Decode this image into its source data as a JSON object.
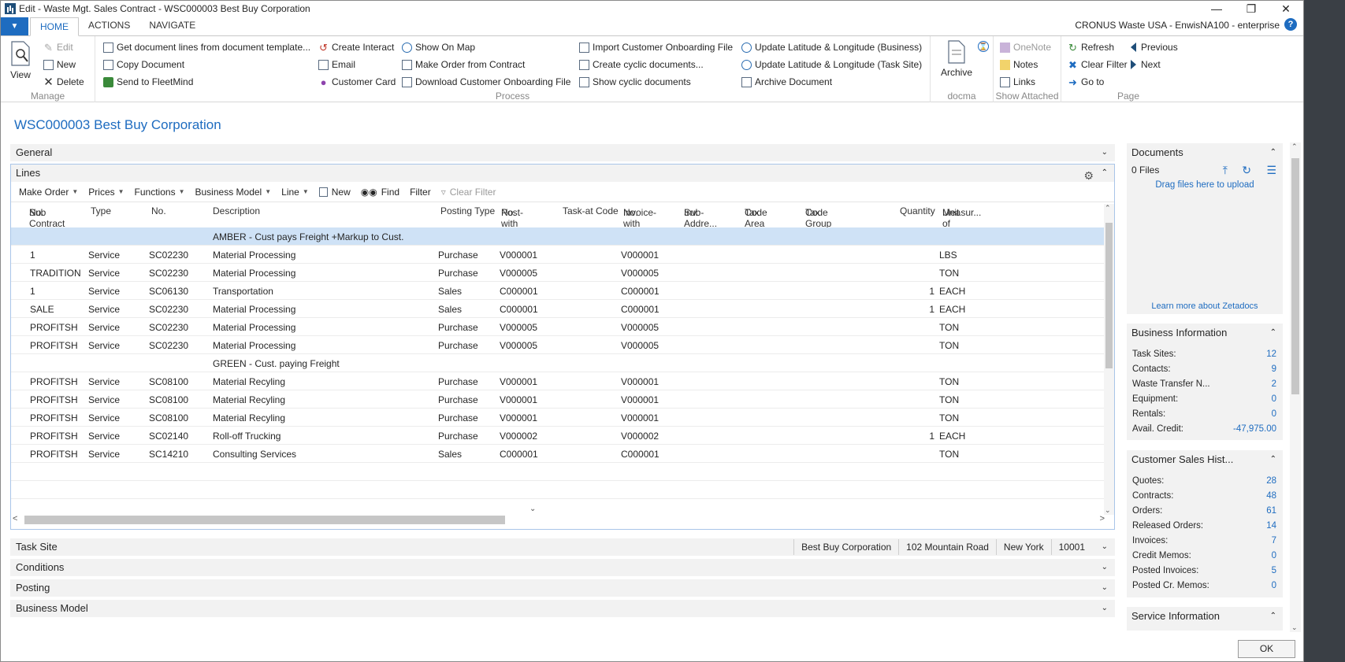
{
  "window": {
    "title": "Edit - Waste Mgt. Sales Contract - WSC000003 Best Buy Corporation",
    "company": "CRONUS Waste USA - EnwisNA100 - enterprise"
  },
  "tabs": [
    "HOME",
    "ACTIONS",
    "NAVIGATE"
  ],
  "ribbon": {
    "manage": {
      "label": "Manage",
      "view": "View",
      "edit": "Edit",
      "new": "New",
      "delete": "Delete"
    },
    "process": {
      "label": "Process",
      "get_lines": "Get document lines from document template...",
      "copy_document": "Copy Document",
      "send_fleetmind": "Send to FleetMind",
      "create_interact": "Create Interact",
      "email": "Email",
      "customer_card": "Customer Card",
      "show_on_map": "Show On Map",
      "make_order": "Make Order from Contract",
      "download_onboarding": "Download Customer  Onboarding File",
      "import_onboarding": "Import Customer Onboarding File",
      "create_cyclic": "Create cyclic documents...",
      "show_cyclic": "Show cyclic documents",
      "update_latlng_business": "Update Latitude & Longitude (Business)",
      "update_latlng_task": "Update Latitude & Longitude (Task Site)",
      "archive_document": "Archive Document"
    },
    "docma": {
      "label": "docma",
      "archive": "Archive"
    },
    "show_attached": {
      "label": "Show Attached",
      "onenote": "OneNote",
      "notes": "Notes",
      "links": "Links"
    },
    "page": {
      "label": "Page",
      "refresh": "Refresh",
      "clear_filter": "Clear Filter",
      "go_to": "Go to",
      "previous": "Previous",
      "next": "Next"
    }
  },
  "page_title": "WSC000003 Best Buy Corporation",
  "sections": {
    "general": "General",
    "lines": "Lines",
    "task_site": "Task Site",
    "conditions": "Conditions",
    "posting": "Posting",
    "business_model": "Business Model"
  },
  "lines_toolbar": {
    "make_order": "Make Order",
    "prices": "Prices",
    "functions": "Functions",
    "business_model": "Business Model",
    "line": "Line",
    "new": "New",
    "find": "Find",
    "filter": "Filter",
    "clear_filter": "Clear Filter"
  },
  "columns": {
    "sub_contract_no": [
      "Sub Contract",
      "No."
    ],
    "type": [
      "Type",
      ""
    ],
    "no": [
      "No.",
      ""
    ],
    "description": [
      "Description",
      ""
    ],
    "posting_type": [
      "Posting Type",
      ""
    ],
    "post_with_no": [
      "Post-with",
      "No."
    ],
    "task_at_code": [
      "Task-at Code",
      ""
    ],
    "invoice_with_no": [
      "Invoice-with",
      "No."
    ],
    "inv_sub_address": [
      "Inv.",
      "Sub-Addre..."
    ],
    "tax_area_code": [
      "Tax Area",
      "Code"
    ],
    "tax_group_code": [
      "Tax Group",
      "Code"
    ],
    "quantity": [
      "Quantity",
      ""
    ],
    "unit_of_measure": [
      "Unit of",
      "Measur..."
    ]
  },
  "rows": [
    {
      "sub": "",
      "type": "",
      "no": "",
      "desc": "AMBER - Cust pays Freight +Markup to Cust.",
      "ptype": "",
      "pwith": "",
      "task": "",
      "iwith": "",
      "qty": "",
      "uom": "",
      "hl": true
    },
    {
      "sub": "1",
      "type": "Service",
      "no": "SC02230",
      "desc": "Material Processing",
      "ptype": "Purchase",
      "pwith": "V000001",
      "task": "",
      "iwith": "V000001",
      "qty": "",
      "uom": "LBS"
    },
    {
      "sub": "TRADITION",
      "type": "Service",
      "no": "SC02230",
      "desc": "Material Processing",
      "ptype": "Purchase",
      "pwith": "V000005",
      "task": "",
      "iwith": "V000005",
      "qty": "",
      "uom": "TON"
    },
    {
      "sub": "1",
      "type": "Service",
      "no": "SC06130",
      "desc": "Transportation",
      "ptype": "Sales",
      "pwith": "C000001",
      "task": "",
      "iwith": "C000001",
      "qty": "1",
      "uom": "EACH"
    },
    {
      "sub": "SALE",
      "type": "Service",
      "no": "SC02230",
      "desc": "Material Processing",
      "ptype": "Sales",
      "pwith": "C000001",
      "task": "",
      "iwith": "C000001",
      "qty": "1",
      "uom": "EACH"
    },
    {
      "sub": "PROFITSH",
      "type": "Service",
      "no": "SC02230",
      "desc": "Material Processing",
      "ptype": "Purchase",
      "pwith": "V000005",
      "task": "",
      "iwith": "V000005",
      "qty": "",
      "uom": "TON"
    },
    {
      "sub": "PROFITSH",
      "type": "Service",
      "no": "SC02230",
      "desc": "Material Processing",
      "ptype": "Purchase",
      "pwith": "V000005",
      "task": "",
      "iwith": "V000005",
      "qty": "",
      "uom": "TON"
    },
    {
      "sub": "",
      "type": "",
      "no": "",
      "desc": "GREEN - Cust. paying Freight",
      "ptype": "",
      "pwith": "",
      "task": "",
      "iwith": "",
      "qty": "",
      "uom": ""
    },
    {
      "sub": "PROFITSH",
      "type": "Service",
      "no": "SC08100",
      "desc": "Material Recyling",
      "ptype": "Purchase",
      "pwith": "V000001",
      "task": "",
      "iwith": "V000001",
      "qty": "",
      "uom": "TON"
    },
    {
      "sub": "PROFITSH",
      "type": "Service",
      "no": "SC08100",
      "desc": "Material Recyling",
      "ptype": "Purchase",
      "pwith": "V000001",
      "task": "",
      "iwith": "V000001",
      "qty": "",
      "uom": "TON"
    },
    {
      "sub": "PROFITSH",
      "type": "Service",
      "no": "SC08100",
      "desc": "Material Recyling",
      "ptype": "Purchase",
      "pwith": "V000001",
      "task": "",
      "iwith": "V000001",
      "qty": "",
      "uom": "TON"
    },
    {
      "sub": "PROFITSH",
      "type": "Service",
      "no": "SC02140",
      "desc": "Roll-off Trucking",
      "ptype": "Purchase",
      "pwith": "V000002",
      "task": "",
      "iwith": "V000002",
      "qty": "1",
      "uom": "EACH"
    },
    {
      "sub": "PROFITSH",
      "type": "Service",
      "no": "SC14210",
      "desc": "Consulting Services",
      "ptype": "Sales",
      "pwith": "C000001",
      "task": "",
      "iwith": "C000001",
      "qty": "",
      "uom": "TON"
    }
  ],
  "task_site_info": [
    "Best Buy Corporation",
    "102 Mountain Road",
    "New York",
    "10001"
  ],
  "documents": {
    "title": "Documents",
    "files": "0 Files",
    "drag_text": "Drag files here to upload",
    "learn_more": "Learn more about Zetadocs"
  },
  "business_info": {
    "title": "Business Information",
    "rows": [
      {
        "label": "Task Sites:",
        "value": "12"
      },
      {
        "label": "Contacts:",
        "value": "9"
      },
      {
        "label": "Waste Transfer N...",
        "value": "2"
      },
      {
        "label": "Equipment:",
        "value": "0"
      },
      {
        "label": "Rentals:",
        "value": "0"
      },
      {
        "label": "Avail. Credit:",
        "value": "-47,975.00"
      }
    ]
  },
  "sales_history": {
    "title": "Customer Sales Hist...",
    "rows": [
      {
        "label": "Quotes:",
        "value": "28"
      },
      {
        "label": "Contracts:",
        "value": "48"
      },
      {
        "label": "Orders:",
        "value": "61"
      },
      {
        "label": "Released Orders:",
        "value": "14"
      },
      {
        "label": "Invoices:",
        "value": "7"
      },
      {
        "label": "Credit Memos:",
        "value": "0"
      },
      {
        "label": "Posted Invoices:",
        "value": "5"
      },
      {
        "label": "Posted Cr. Memos:",
        "value": "0"
      }
    ]
  },
  "service_info": {
    "title": "Service Information"
  },
  "ok_button": "OK",
  "colors": {
    "accent": "#1e6cc0",
    "selected_row": "#cfe2f6",
    "panel": "#f2f2f2"
  }
}
